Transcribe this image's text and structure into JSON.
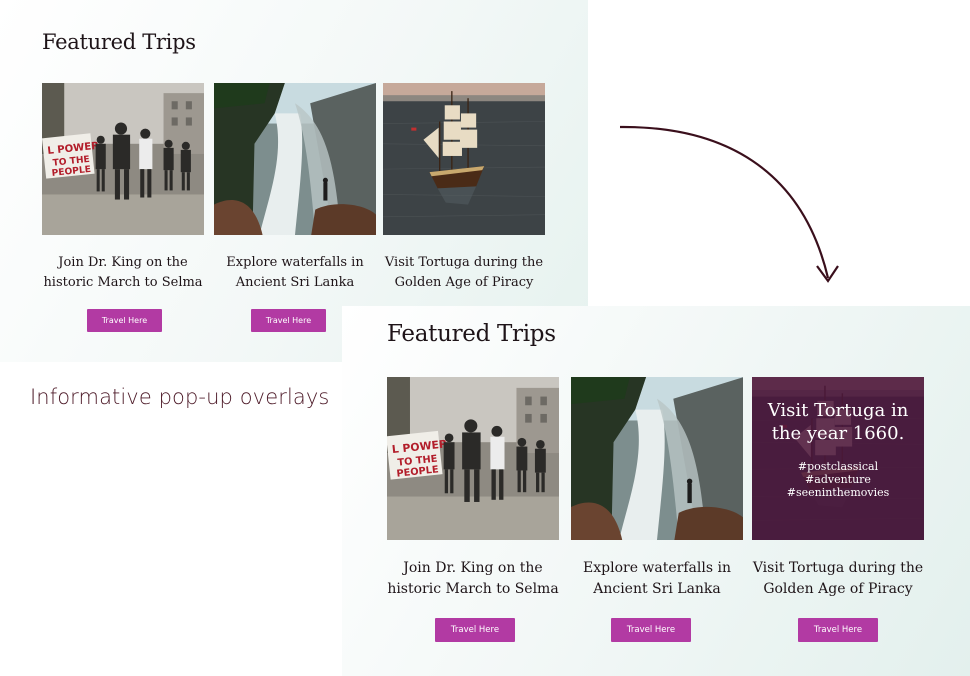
{
  "before": {
    "title": "Featured Trips",
    "cards": [
      {
        "caption": [
          "Join Dr. King on the",
          "historic March to Selma"
        ],
        "button": "Travel Here",
        "image": "march-photo"
      },
      {
        "caption": [
          "Explore waterfalls in",
          "Ancient Sri Lanka"
        ],
        "button": "Travel Here",
        "image": "waterfall-photo"
      },
      {
        "caption": [
          "Visit Tortuga during the",
          "Golden Age of Piracy"
        ],
        "button": "Travel Here",
        "image": "ship-photo"
      }
    ]
  },
  "after": {
    "title": "Featured Trips",
    "cards": [
      {
        "caption": [
          "Join Dr. King on the",
          "historic March to Selma"
        ],
        "button": "Travel Here",
        "image": "march-photo"
      },
      {
        "caption": [
          "Explore waterfalls in",
          "Ancient Sri Lanka"
        ],
        "button": "Travel Here",
        "image": "waterfall-photo"
      },
      {
        "caption": [
          "Visit Tortuga during the",
          "Golden Age of Piracy"
        ],
        "button": "Travel Here",
        "image": "ship-photo",
        "overlay": {
          "headline": [
            "Visit Tortuga in",
            "the year 1660."
          ],
          "tags": [
            "#postclassical",
            "#adventure",
            "#seeninthemovies"
          ]
        }
      }
    ]
  },
  "annotation": {
    "label": "Informative pop-up overlays",
    "arrow": "arrow-icon"
  },
  "colors": {
    "button": "#b23aa3",
    "overlay": "#4c163c",
    "label": "#4d1a28",
    "arrow": "#3a0f1c"
  }
}
